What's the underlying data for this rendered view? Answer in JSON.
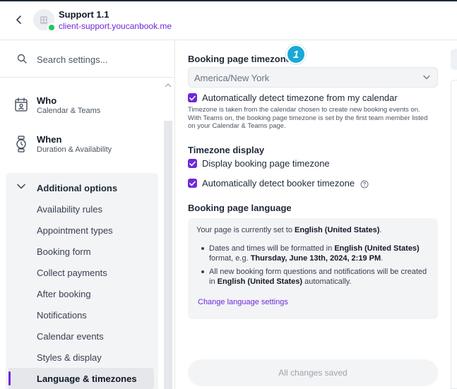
{
  "header": {
    "title": "Support 1.1",
    "url": "client-support.youcanbook.me"
  },
  "sidebar": {
    "search_placeholder": "Search settings...",
    "main_items": [
      {
        "title": "Who",
        "subtitle": "Calendar & Teams",
        "icon": "calendar-user-icon"
      },
      {
        "title": "When",
        "subtitle": "Duration & Availability",
        "icon": "watch-icon"
      }
    ],
    "group": {
      "label": "Additional options",
      "items": [
        "Availability rules",
        "Appointment types",
        "Booking form",
        "Collect payments",
        "After booking",
        "Notifications",
        "Calendar events",
        "Styles & display",
        "Language & timezones"
      ],
      "active": "Language & timezones"
    }
  },
  "main": {
    "timezone": {
      "title": "Booking page timezone",
      "badge": "1",
      "selected": "America/New York",
      "auto_detect_label": "Automatically detect timezone from my calendar",
      "auto_detect_checked": true,
      "help_text": "Timezone is taken from the calendar chosen to create new booking events on. With Teams on, the booking page timezone is set by the first team member listed on your Calendar & Teams page."
    },
    "display": {
      "title": "Timezone display",
      "display_label": "Display booking page timezone",
      "display_checked": true,
      "booker_label": "Automatically detect booker timezone",
      "booker_checked": true
    },
    "language": {
      "title": "Booking page language",
      "current_prefix": "Your page is currently set to",
      "current_value": "English (United States)",
      "current_suffix": ".",
      "bullet1_a": "Dates and times will be formatted in",
      "bullet1_b": "English (United States)",
      "bullet1_c": "format, e.g.",
      "bullet1_d": "Thursday, June 13th, 2024, 2:19 PM",
      "bullet1_e": ".",
      "bullet2_a": "All new booking form questions and notifications will be created in",
      "bullet2_b": "English (United States)",
      "bullet2_c": "automatically.",
      "link": "Change language settings"
    },
    "save_label": "All changes saved"
  },
  "colors": {
    "accent": "#6d28d9",
    "badge": "#1aa8d6",
    "status_online": "#22c55e"
  }
}
